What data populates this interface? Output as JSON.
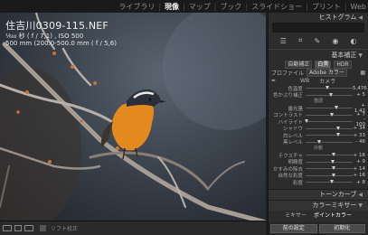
{
  "modules": [
    {
      "label": "ライブラリ",
      "active": false
    },
    {
      "label": "現像",
      "active": true
    },
    {
      "label": "マップ",
      "active": false
    },
    {
      "label": "ブック",
      "active": false
    },
    {
      "label": "スライドショー",
      "active": false
    },
    {
      "label": "プリント",
      "active": false
    },
    {
      "label": "Web",
      "active": false
    }
  ],
  "photo": {
    "filename": "住吉川0309-115.NEF",
    "exposure": "⅟₆₀₀ 秒 ( f / 7,1) , ISO 500",
    "lens": "500 mm (200.0-500.0 mm ( f / 5,6)"
  },
  "toolbar": {
    "softproof": "ソフト校正"
  },
  "panel": {
    "histogram": "ヒストグラム",
    "basic": "基本補正",
    "auto": "自動補正",
    "color": "白黒",
    "hdr": "HDR",
    "profile_label": "プロファイル",
    "profile_value": "Adobe カラー",
    "wb_label": "WB",
    "wb_value": "カメラ",
    "tone_label": "階調",
    "presence_label": "外観",
    "sliders": [
      {
        "label": "色温度",
        "value": "5,476",
        "pos": 0.45
      },
      {
        "label": "色かぶり補正",
        "value": "+ 5",
        "pos": 0.52
      },
      {
        "label": "露光量",
        "value": "+ 1.42",
        "pos": 0.63
      },
      {
        "label": "コントラスト",
        "value": "+ 7",
        "pos": 0.54
      },
      {
        "label": "ハイライト",
        "value": "- 100",
        "pos": 0.02
      },
      {
        "label": "シャドウ",
        "value": "+ 34",
        "pos": 0.66
      },
      {
        "label": "白レベル",
        "value": "+ 33",
        "pos": 0.66
      },
      {
        "label": "黒レベル",
        "value": "- 46",
        "pos": 0.27
      },
      {
        "label": "テクスチャ",
        "value": "+ 16",
        "pos": 0.58
      },
      {
        "label": "明瞭度",
        "value": "+ 9",
        "pos": 0.55
      },
      {
        "label": "かすみの除去",
        "value": "+ 14",
        "pos": 0.57
      },
      {
        "label": "自然な彩度",
        "value": "+ 16",
        "pos": 0.58
      },
      {
        "label": "彩度",
        "value": "+ 8",
        "pos": 0.54
      }
    ],
    "tone_curve": "トーンカーブ",
    "color_mixer": "カラーミキサー",
    "mixer_tab1": "ミキサー",
    "mixer_tab2": "ポイントカラー",
    "prev_btn": "前の設定",
    "reset_btn": "初期化"
  },
  "colors": {
    "bird_orange": "#e48a1e",
    "bird_dark": "#2b2f3a"
  }
}
